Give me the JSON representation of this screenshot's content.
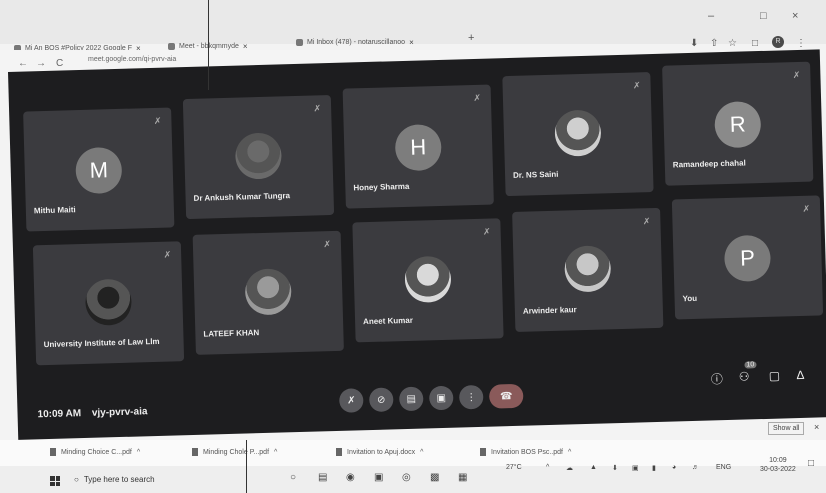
{
  "browser": {
    "tabs": [
      {
        "title": "Mi An BOS #Policy 2022 Google F",
        "close": "×"
      },
      {
        "title": "Meet - bbkqmmyde",
        "close": "×"
      },
      {
        "title": "Mi Inbox (478) - notaruscillanoo",
        "close": "×"
      }
    ],
    "new_tab": "+",
    "window_controls": {
      "minimize": "–",
      "maximize": "□",
      "close": "×"
    },
    "nav": {
      "back": "←",
      "forward": "→",
      "reload": "C"
    },
    "url": "meet.google.com/qi-pvrv-aia",
    "tools": {
      "download": "⬇",
      "share": "⇧",
      "bookmark": "☆",
      "extension": "□",
      "menu": "⋮"
    },
    "profile_initial": "R"
  },
  "meet": {
    "participants": [
      {
        "name": "Mithu Maiti",
        "initial": "M",
        "color": "#7a7a7a",
        "photo": false
      },
      {
        "name": "Dr Ankush Kumar Tungra",
        "initial": "",
        "color": "#6a6a6a",
        "photo": true
      },
      {
        "name": "Honey Sharma",
        "initial": "H",
        "color": "#7d7d7d",
        "photo": false
      },
      {
        "name": "Dr. NS Saini",
        "initial": "",
        "color": "#cfcfcf",
        "photo": true
      },
      {
        "name": "Ramandeep chahal",
        "initial": "R",
        "color": "#8a8a8a",
        "photo": false
      },
      {
        "name": "University Institute of Law Llm",
        "initial": "",
        "color": "#222222",
        "photo": true
      },
      {
        "name": "LATEEF KHAN",
        "initial": "",
        "color": "#9a9a9a",
        "photo": true
      },
      {
        "name": "Aneet Kumar",
        "initial": "",
        "color": "#d9d9d9",
        "photo": true
      },
      {
        "name": "Arwinder kaur",
        "initial": "",
        "color": "#c7c7c7",
        "photo": true
      },
      {
        "name": "You",
        "initial": "P",
        "color": "#7a7a7a",
        "photo": false
      }
    ],
    "mic_glyph": "✗",
    "time": "10:09 AM",
    "meeting_code": "vjy-pvrv-aia",
    "controls": {
      "mic": "✗",
      "camera": "⊘",
      "captions": "▤",
      "present": "▣",
      "more": "⋮",
      "end": "☎"
    },
    "right_controls": {
      "info": "ⓘ",
      "people": "⚇",
      "people_count": "10",
      "chat": "▢",
      "activities": "∆"
    }
  },
  "downloads": {
    "items": [
      {
        "name": "Minding Choice C...pdf",
        "chevron": "^"
      },
      {
        "name": "Minding Chole P...pdf",
        "chevron": "^"
      },
      {
        "name": "Invitation to Apuj.docx",
        "chevron": "^"
      },
      {
        "name": "Invitation BOS Psc..pdf",
        "chevron": "^"
      }
    ],
    "show_all": "Show all",
    "close": "×"
  },
  "taskbar": {
    "search_placeholder": "Type here to search",
    "weather": "27°C",
    "language": "ENG",
    "time": "10:09",
    "date": "30-03-2022"
  }
}
